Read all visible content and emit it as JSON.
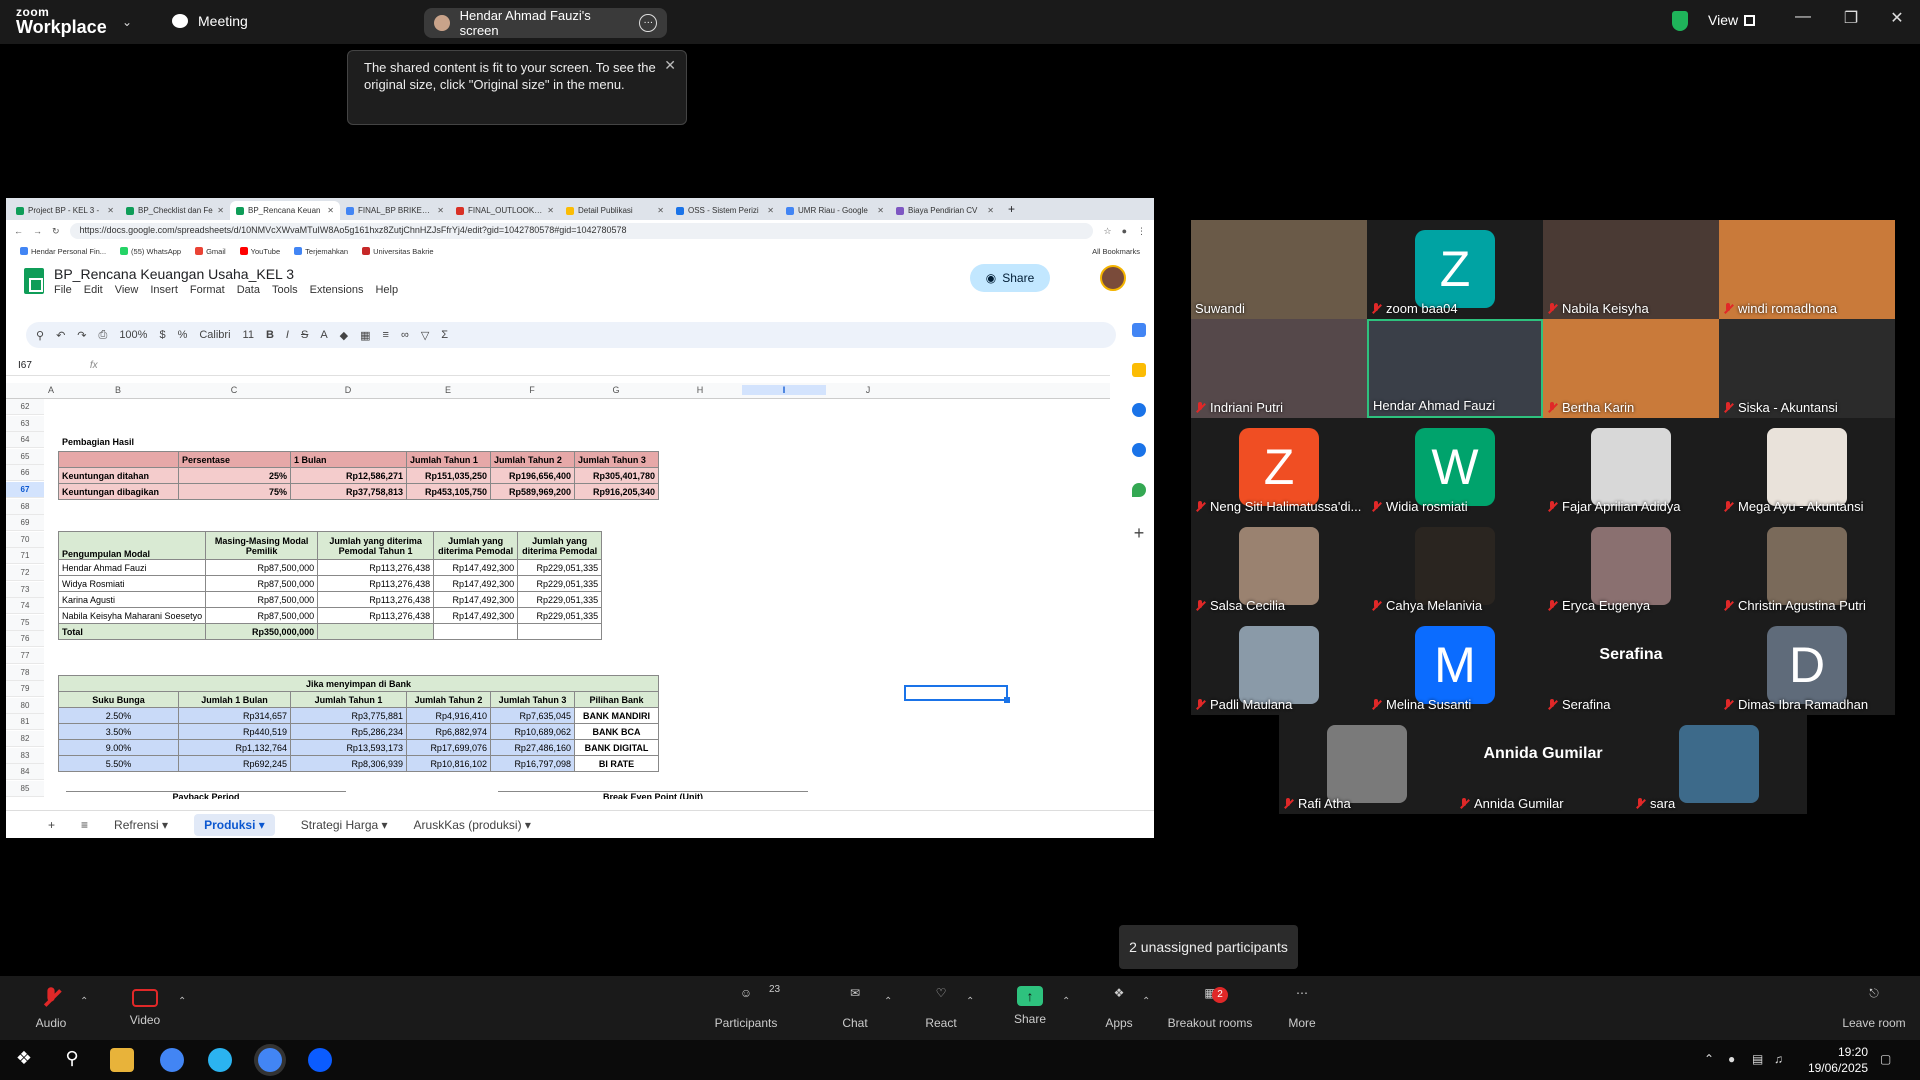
{
  "zoom": {
    "brand_line1": "zoom",
    "brand_line2": "Workplace",
    "meeting_label": "Meeting",
    "share_pill": "Hendar Ahmad Fauzi's screen",
    "view_label": "View",
    "tooltip": "The shared content is fit to your screen. To see the original size, click \"Original size\" in the menu.",
    "unassigned": "2 unassigned participants",
    "participants_count": "23",
    "breakout_badge": "2",
    "controls": {
      "audio": "Audio",
      "video": "Video",
      "participants": "Participants",
      "chat": "Chat",
      "react": "React",
      "share": "Share",
      "apps": "Apps",
      "breakout": "Breakout rooms",
      "more": "More",
      "leave": "Leave room"
    }
  },
  "browser": {
    "tabs": [
      {
        "label": "Project BP - KEL 3 -",
        "color": "#0f9d58"
      },
      {
        "label": "BP_Checklist dan Fe",
        "color": "#0f9d58"
      },
      {
        "label": "BP_Rencana Keuan",
        "color": "#0f9d58"
      },
      {
        "label": "FINAL_BP BRIKET U",
        "color": "#4285f4"
      },
      {
        "label": "FINAL_OUTLOOK_K",
        "color": "#d93025"
      },
      {
        "label": "Detail Publikasi",
        "color": "#fbbc04"
      },
      {
        "label": "OSS - Sistem Perizi",
        "color": "#1a73e8"
      },
      {
        "label": "UMR Riau - Google",
        "color": "#4285f4"
      },
      {
        "label": "Biaya Pendirian CV",
        "color": "#7e57c2"
      }
    ],
    "url": "https://docs.google.com/spreadsheets/d/10NMVcXWvaMTuIW8Ao5g161hxz8ZutjChnHZJsFfrYj4/edit?gid=1042780578#gid=1042780578",
    "bookmarks": [
      "Hendar Personal Fin...",
      "(55) WhatsApp",
      "Gmail",
      "YouTube",
      "Terjemahkan",
      "Universitas Bakrie"
    ],
    "all_bookmarks": "All Bookmarks"
  },
  "sheet": {
    "title": "BP_Rencana Keuangan Usaha_KEL 3",
    "menu": [
      "File",
      "Edit",
      "View",
      "Insert",
      "Format",
      "Data",
      "Tools",
      "Extensions",
      "Help"
    ],
    "share_label": "Share",
    "zoom": "100%",
    "font": "Calibri",
    "font_size": "11",
    "cell_ref": "I67",
    "columns": [
      "A",
      "B",
      "C",
      "D",
      "E",
      "F",
      "G",
      "H",
      "I",
      "J"
    ],
    "rows": [
      "62",
      "63",
      "64",
      "65",
      "66",
      "67",
      "68",
      "69",
      "70",
      "71",
      "72",
      "73",
      "74",
      "75",
      "76",
      "77",
      "78",
      "79",
      "80",
      "81",
      "82",
      "83",
      "84",
      "85"
    ],
    "pembagian": {
      "title": "Pembagian Hasil",
      "headers": [
        "",
        "Persentase",
        "1 Bulan",
        "Jumlah Tahun 1",
        "Jumlah Tahun 2",
        "Jumlah Tahun 3"
      ],
      "rows": [
        [
          "Keuntungan ditahan",
          "25%",
          "Rp12,586,271",
          "Rp151,035,250",
          "Rp196,656,400",
          "Rp305,401,780"
        ],
        [
          "Keuntungan dibagikan",
          "75%",
          "Rp37,758,813",
          "Rp453,105,750",
          "Rp589,969,200",
          "Rp916,205,340"
        ]
      ]
    },
    "modal": {
      "headers": [
        "Pengumpulan Modal",
        "Masing-Masing Modal Pemilik",
        "Jumlah yang diterima Pemodal Tahun 1",
        "Jumlah yang diterima Pemodal",
        "Jumlah yang diterima Pemodal"
      ],
      "rows": [
        [
          "Hendar Ahmad Fauzi",
          "Rp87,500,000",
          "Rp113,276,438",
          "Rp147,492,300",
          "Rp229,051,335"
        ],
        [
          "Widya Rosmiati",
          "Rp87,500,000",
          "Rp113,276,438",
          "Rp147,492,300",
          "Rp229,051,335"
        ],
        [
          "Karina Agusti",
          "Rp87,500,000",
          "Rp113,276,438",
          "Rp147,492,300",
          "Rp229,051,335"
        ],
        [
          "Nabila Keisyha Maharani Soesetyo",
          "Rp87,500,000",
          "Rp113,276,438",
          "Rp147,492,300",
          "Rp229,051,335"
        ]
      ],
      "total_label": "Total",
      "total_value": "Rp350,000,000"
    },
    "bank": {
      "title": "Jika menyimpan di Bank",
      "headers": [
        "Suku Bunga",
        "Jumlah 1 Bulan",
        "Jumlah Tahun 1",
        "Jumlah Tahun 2",
        "Jumlah Tahun 3",
        "Pilihan Bank"
      ],
      "rows": [
        [
          "2.50%",
          "Rp314,657",
          "Rp3,775,881",
          "Rp4,916,410",
          "Rp7,635,045",
          "BANK MANDIRI"
        ],
        [
          "3.50%",
          "Rp440,519",
          "Rp5,286,234",
          "Rp6,882,974",
          "Rp10,689,062",
          "BANK BCA"
        ],
        [
          "9.00%",
          "Rp1,132,764",
          "Rp13,593,173",
          "Rp17,699,076",
          "Rp27,486,160",
          "BANK DIGITAL"
        ],
        [
          "5.50%",
          "Rp692,245",
          "Rp8,306,939",
          "Rp10,816,102",
          "Rp16,797,098",
          "BI RATE"
        ]
      ]
    },
    "row85": [
      "Payback Period",
      "Break Even Point (Unit)"
    ],
    "sheet_tabs": [
      "Refrensi",
      "Produksi",
      "Strategi Harga",
      "AruskKas (produksi)"
    ]
  },
  "participants": [
    {
      "name": "Suwandi",
      "type": "photo",
      "color": "#6a5a48",
      "muted": false
    },
    {
      "name": "zoom baa04",
      "type": "letter",
      "letter": "Z",
      "color": "#00a3a3",
      "muted": true
    },
    {
      "name": "Nabila Keisyha",
      "type": "photo",
      "color": "#4a3a34",
      "muted": true
    },
    {
      "name": "windi romadhona",
      "type": "photo",
      "color": "#c97a3a",
      "muted": true
    },
    {
      "name": "Indriani Putri",
      "type": "photo",
      "color": "#55484a",
      "muted": true
    },
    {
      "name": "Hendar Ahmad Fauzi",
      "type": "photo",
      "color": "#3a3f48",
      "muted": false
    },
    {
      "name": "Bertha Karin",
      "type": "photo",
      "color": "#c97a3a",
      "muted": true
    },
    {
      "name": "Siska - Akuntansi",
      "type": "photo",
      "color": "#2b2b2b",
      "muted": true
    },
    {
      "name": "Neng Siti Halimatussa'di...",
      "type": "letter",
      "letter": "Z",
      "color": "#f04e23",
      "muted": true
    },
    {
      "name": "Widia rosmiati",
      "type": "letter",
      "letter": "W",
      "color": "#00a36c",
      "muted": true
    },
    {
      "name": "Fajar Aprilian Adidya",
      "type": "photo",
      "color": "#d8d8d8",
      "muted": true
    },
    {
      "name": "Mega Ayu - Akuntansi",
      "type": "photo",
      "color": "#e9e2da",
      "muted": true
    },
    {
      "name": "Salsa Cecilia",
      "type": "photo",
      "color": "#9a8270",
      "muted": true
    },
    {
      "name": "Cahya Melanivia",
      "type": "photo",
      "color": "#2a2520",
      "muted": true
    },
    {
      "name": "Eryca Eugenya",
      "type": "photo",
      "color": "#8a7070",
      "muted": true
    },
    {
      "name": "Christin Agustina Putri",
      "type": "photo",
      "color": "#7a6a5a",
      "muted": true
    },
    {
      "name": "Padli Maulana",
      "type": "photo",
      "color": "#8a9aa8",
      "muted": true
    },
    {
      "name": "Melina Susanti",
      "type": "letter",
      "letter": "M",
      "color": "#0b6cff",
      "muted": true
    },
    {
      "name": "Serafina",
      "type": "name",
      "muted": true
    },
    {
      "name": "Dimas Ibra Ramadhan",
      "type": "letter",
      "letter": "D",
      "color": "#5f6b7a",
      "muted": true
    },
    {
      "name": "Rafi Atha",
      "type": "photo",
      "color": "#7a7a7a",
      "muted": true
    },
    {
      "name": "Annida Gumilar",
      "type": "name",
      "muted": true
    },
    {
      "name": "sara",
      "type": "photo",
      "color": "#3d6a8a",
      "muted": true
    }
  ],
  "taskbar": {
    "time": "19:20",
    "date": "19/06/2025"
  }
}
